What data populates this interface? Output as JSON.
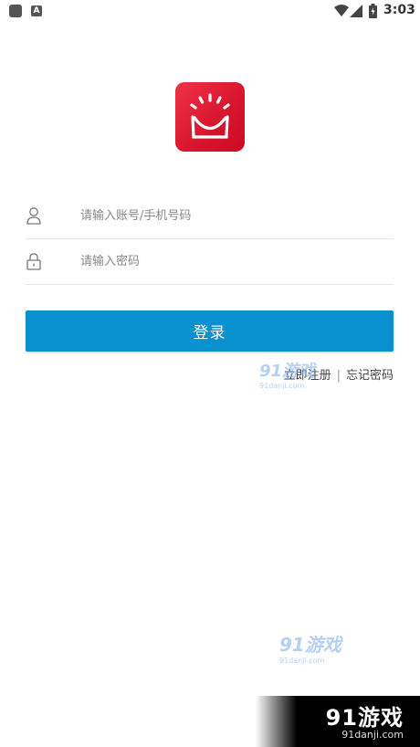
{
  "status_bar": {
    "time": "3:03",
    "left_badge": "A",
    "icons": [
      "app-icon",
      "a-badge-icon",
      "wifi-icon",
      "signal-icon",
      "battery-icon"
    ]
  },
  "logo": {
    "icon": "smile-shopping-bag-icon",
    "color": "#e01f36"
  },
  "form": {
    "account_placeholder": "请输入账号/手机号码",
    "account_value": "",
    "password_placeholder": "请输入密码",
    "password_value": "",
    "account_icon": "user-icon",
    "password_icon": "lock-icon"
  },
  "login_button": {
    "label": "登录",
    "color": "#0890cf"
  },
  "links": {
    "register": "立即注册",
    "separator": "|",
    "forgot": "忘记密码"
  },
  "watermarks": {
    "brand": "91游戏",
    "url": "91danji.com"
  }
}
